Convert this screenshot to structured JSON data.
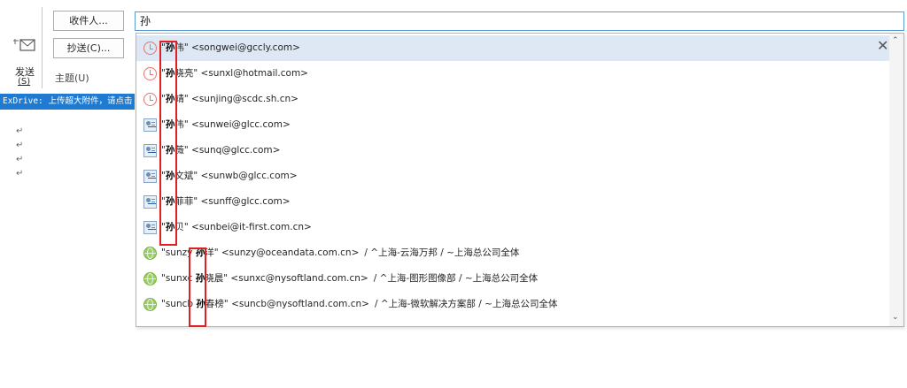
{
  "compose": {
    "send_label": "发送",
    "send_key": "(S)",
    "to_button": "收件人...",
    "cc_button": "抄送(C)...",
    "subject_label": "主题(U)",
    "exdrive_text": "ExDrive: 上传超大附件，请点击"
  },
  "to_field": {
    "value": "孙"
  },
  "suggestions": [
    {
      "icon": "clock-icon",
      "match": "孙",
      "name_rest": "伟",
      "email": "<songwei@gccly.com>",
      "extra": ""
    },
    {
      "icon": "clock-icon",
      "match": "孙",
      "name_rest": "晓亮",
      "email": "<sunxl@hotmail.com>",
      "extra": ""
    },
    {
      "icon": "clock-icon",
      "match": "孙",
      "name_rest": "靖",
      "email": "<sunjing@scdc.sh.cn>",
      "extra": ""
    },
    {
      "icon": "contact-icon",
      "match": "孙",
      "name_rest": "伟",
      "email": "<sunwei@glcc.com>",
      "extra": ""
    },
    {
      "icon": "contact-icon",
      "match": "孙",
      "name_rest": "薇",
      "email": "<sunq@glcc.com>",
      "extra": ""
    },
    {
      "icon": "contact-icon",
      "match": "孙",
      "name_rest": "文斌",
      "email": "<sunwb@glcc.com>",
      "extra": ""
    },
    {
      "icon": "contact-icon",
      "match": "孙",
      "name_rest": "菲菲",
      "email": "<sunff@glcc.com>",
      "extra": ""
    },
    {
      "icon": "contact-icon",
      "match": "孙",
      "name_rest": "贝",
      "email": "<sunbei@it-first.com.cn>",
      "extra": ""
    },
    {
      "icon": "globe-icon",
      "prefix": "sunzy",
      "match": "孙",
      "name_rest": "洋",
      "email": "<sunzy@oceandata.com.cn>",
      "extra": "/ ^上海-云海万邦 / ~上海总公司全体"
    },
    {
      "icon": "globe-icon",
      "prefix": "sunxc",
      "match": "孙",
      "name_rest": "晓晨",
      "email": "<sunxc@nysoftland.com.cn>",
      "extra": "/ ^上海-图形图像部 / ~上海总公司全体"
    },
    {
      "icon": "globe-icon",
      "prefix": "suncb",
      "match": "孙",
      "name_rest": "春榜",
      "email": "<suncb@nysoftland.com.cn>",
      "extra": "/ ^上海-微软解决方案部 / ~上海总公司全体"
    }
  ],
  "colors": {
    "accent": "#1e7bd1",
    "highlight": "#e02020",
    "selected_row": "#dde8f4"
  }
}
